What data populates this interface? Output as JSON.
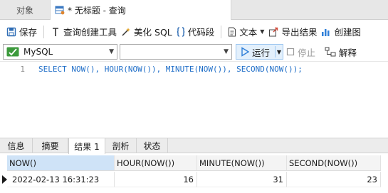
{
  "tabs": {
    "objects": "对象",
    "query": "* 无标题 - 查询"
  },
  "toolbar": {
    "save": "保存",
    "query_builder": "查询创建工具",
    "beautify_sql": "美化 SQL",
    "code_snippet": "代码段",
    "text": "文本",
    "export_result": "导出结果",
    "create_chart": "创建图"
  },
  "connbar": {
    "connection": "MySQL",
    "database": "",
    "run": "运行",
    "stop": "停止",
    "explain": "解释"
  },
  "editor": {
    "line_number": "1",
    "code": "SELECT NOW(), HOUR(NOW()), MINUTE(NOW()), SECOND(NOW());"
  },
  "result_tabs": [
    "信息",
    "摘要",
    "结果 1",
    "剖析",
    "状态"
  ],
  "grid": {
    "columns": [
      "NOW()",
      "HOUR(NOW())",
      "MINUTE(NOW())",
      "SECOND(NOW())"
    ],
    "rows": [
      [
        "2022-02-13 16:31:23",
        "16",
        "31",
        "23"
      ]
    ]
  },
  "colors": {
    "accent": "#2f7fd8",
    "run_bg": "#e3f0fc",
    "header_selected": "#cfe3f7",
    "code": "#1f6ec8"
  },
  "icons": {
    "query_tab": "query-table-icon",
    "save": "save-icon",
    "query_builder": "wrench-icon",
    "beautify": "magic-wand-icon",
    "snippet": "braces-icon",
    "text": "document-icon",
    "export": "export-icon",
    "chart": "chart-icon",
    "connection": "mysql-connection-icon",
    "run": "play-icon",
    "stop": "stop-icon",
    "explain": "explain-icon"
  }
}
